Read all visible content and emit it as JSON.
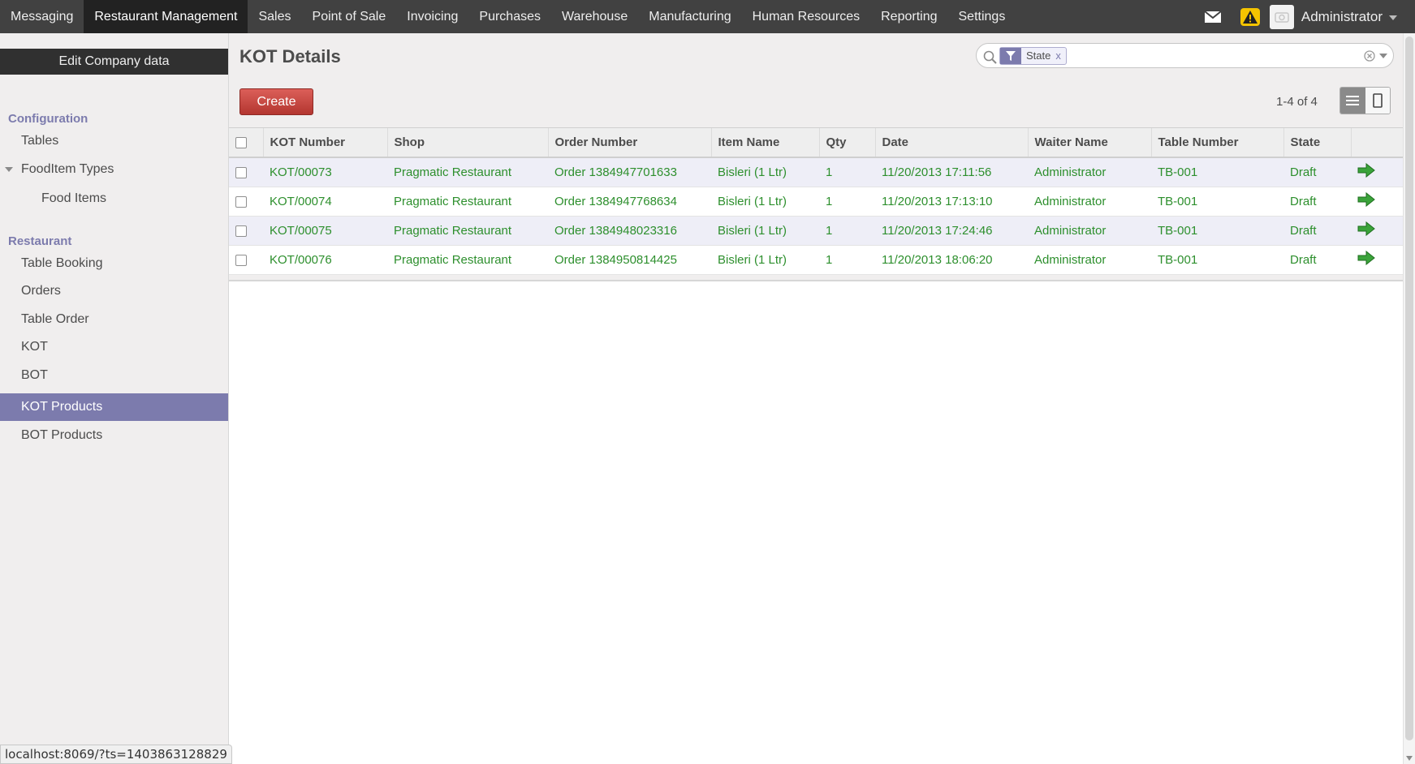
{
  "topmenu": {
    "items": [
      {
        "label": "Messaging"
      },
      {
        "label": "Restaurant Management"
      },
      {
        "label": "Sales"
      },
      {
        "label": "Point of Sale"
      },
      {
        "label": "Invoicing"
      },
      {
        "label": "Purchases"
      },
      {
        "label": "Warehouse"
      },
      {
        "label": "Manufacturing"
      },
      {
        "label": "Human Resources"
      },
      {
        "label": "Reporting"
      },
      {
        "label": "Settings"
      }
    ],
    "active_index": 1,
    "user_name": "Administrator",
    "icons": {
      "mail": "mail-icon",
      "warning": "warning-icon",
      "caret": "caret-down-icon"
    }
  },
  "sidebar": {
    "edit_company_label": "Edit Company data",
    "sections": [
      {
        "title": "Configuration",
        "items": [
          {
            "label": "Tables"
          },
          {
            "label": "FoodItem Types"
          },
          {
            "label": "Food Items"
          }
        ]
      },
      {
        "title": "Restaurant",
        "items": [
          {
            "label": "Table Booking"
          },
          {
            "label": "Orders"
          },
          {
            "label": "Table Order"
          },
          {
            "label": "KOT"
          },
          {
            "label": "BOT"
          },
          {
            "label": "KOT Products"
          },
          {
            "label": "BOT Products"
          }
        ]
      }
    ],
    "active_item": "KOT Products"
  },
  "main": {
    "title": "KOT Details",
    "search": {
      "facet_label": "State",
      "facet_close": "x",
      "value": ""
    },
    "create_label": "Create",
    "pager": "1-4 of 4",
    "table": {
      "columns": [
        "KOT Number",
        "Shop",
        "Order Number",
        "Item Name",
        "Qty",
        "Date",
        "Waiter Name",
        "Table Number",
        "State"
      ],
      "rows": [
        [
          "KOT/00073",
          "Pragmatic Restaurant",
          "Order 1384947701633",
          "Bisleri (1 Ltr)",
          "1",
          "11/20/2013 17:11:56",
          "Administrator",
          "TB-001",
          "Draft"
        ],
        [
          "KOT/00074",
          "Pragmatic Restaurant",
          "Order 1384947768634",
          "Bisleri (1 Ltr)",
          "1",
          "11/20/2013 17:13:10",
          "Administrator",
          "TB-001",
          "Draft"
        ],
        [
          "KOT/00075",
          "Pragmatic Restaurant",
          "Order 1384948023316",
          "Bisleri (1 Ltr)",
          "1",
          "11/20/2013 17:24:46",
          "Administrator",
          "TB-001",
          "Draft"
        ],
        [
          "KOT/00076",
          "Pragmatic Restaurant",
          "Order 1384950814425",
          "Bisleri (1 Ltr)",
          "1",
          "11/20/2013 18:06:20",
          "Administrator",
          "TB-001",
          "Draft"
        ]
      ]
    }
  },
  "status_url": "localhost:8069/?ts=1403863128829",
  "colors": {
    "topbar": "#414141",
    "accent": "#7c7bad",
    "create": "#c9453f",
    "row_text": "#2d8f2d"
  }
}
